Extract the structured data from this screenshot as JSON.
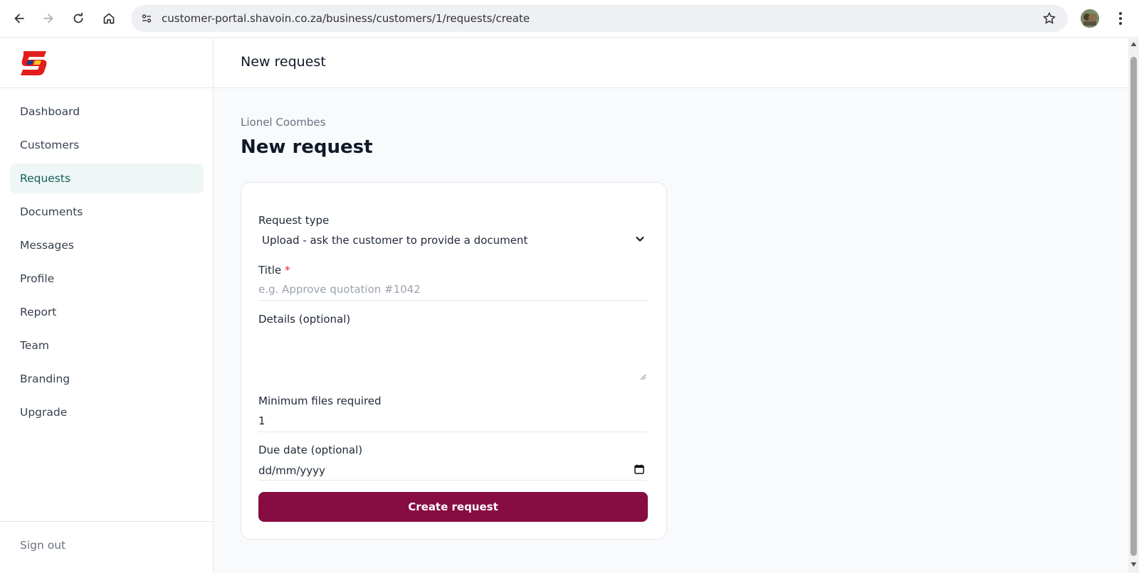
{
  "browser": {
    "url": "customer-portal.shavoin.co.za/business/customers/1/requests/create",
    "icons": [
      "back-arrow-icon",
      "forward-arrow-icon",
      "reload-icon",
      "home-icon",
      "site-info-icon",
      "bookmark-star-icon",
      "profile-avatar-icon",
      "more-vert-icon"
    ]
  },
  "brand": {
    "logo_letter": "S",
    "colors": {
      "primary": "#e31d1d",
      "accent": "#f5c518",
      "secondary": "#1e3a8a"
    }
  },
  "sidebar": {
    "items": [
      {
        "label": "Dashboard",
        "active": false
      },
      {
        "label": "Customers",
        "active": false
      },
      {
        "label": "Requests",
        "active": true
      },
      {
        "label": "Documents",
        "active": false
      },
      {
        "label": "Messages",
        "active": false
      },
      {
        "label": "Profile",
        "active": false
      },
      {
        "label": "Report",
        "active": false
      },
      {
        "label": "Team",
        "active": false
      },
      {
        "label": "Branding",
        "active": false
      },
      {
        "label": "Upgrade",
        "active": false
      }
    ],
    "sign_out": "Sign out"
  },
  "header": {
    "title": "New request"
  },
  "page": {
    "breadcrumb": "Lionel Coombes",
    "title": "New request"
  },
  "form": {
    "request_type": {
      "label": "Request type",
      "value": "Upload - ask the customer to provide a document"
    },
    "title": {
      "label": "Title",
      "required_mark": "*",
      "placeholder": "e.g. Approve quotation #1042",
      "value": ""
    },
    "details": {
      "label": "Details (optional)",
      "value": ""
    },
    "min_files": {
      "label": "Minimum files required",
      "value": "1"
    },
    "due_date": {
      "label": "Due date (optional)",
      "placeholder": "dd/mm/yyyy"
    },
    "submit_label": "Create request",
    "submit_color": "#870c42"
  }
}
